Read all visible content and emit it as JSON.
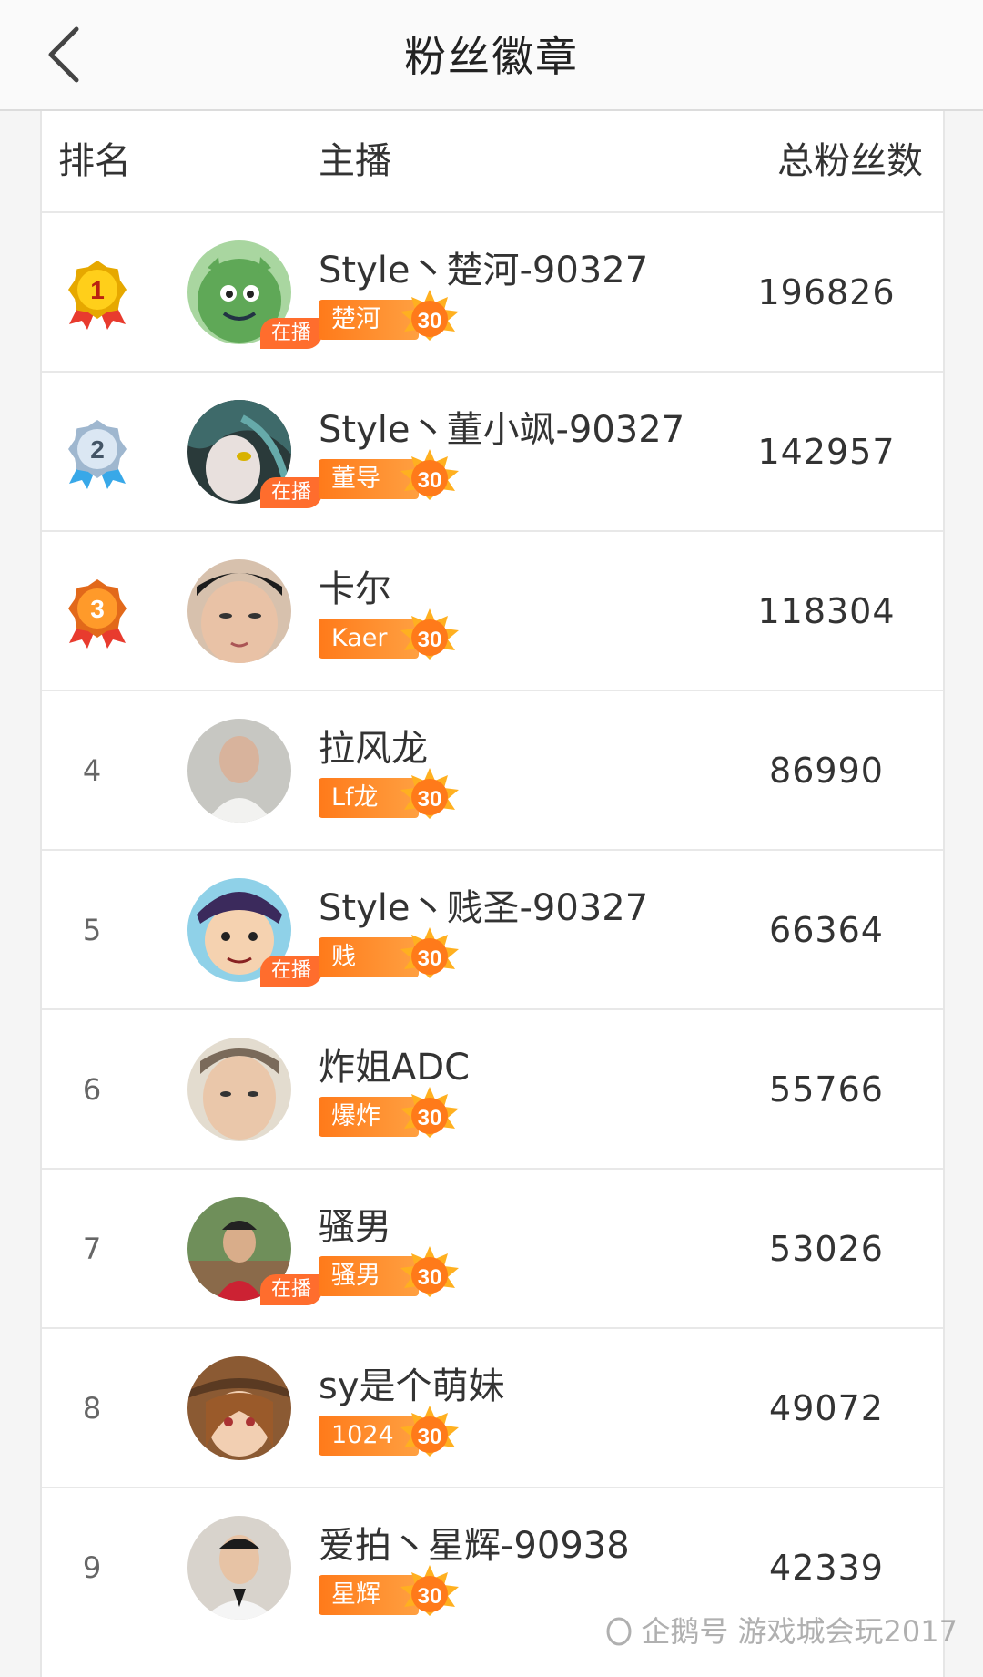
{
  "header": {
    "title": "粉丝徽章"
  },
  "columns": {
    "rank": "排名",
    "anchor": "主播",
    "fans": "总粉丝数"
  },
  "live_label": "在播",
  "colors": {
    "accent": "#ff7a1a",
    "gold": "#f5c400",
    "silver": "#b9cde0",
    "bronze": "#ff8c1a",
    "divider": "#e8e8e8"
  },
  "rows": [
    {
      "rank": "1",
      "medal": "gold-medal-icon",
      "name": "Style丶楚河-90327",
      "badge": "楚河",
      "level": "30",
      "fans": "196826",
      "live": true,
      "avatar": "green-monster-avatar"
    },
    {
      "rank": "2",
      "medal": "silver-medal-icon",
      "name": "Style丶董小飒-90327",
      "badge": "董导",
      "level": "30",
      "fans": "142957",
      "live": true,
      "avatar": "anime-girl-avatar"
    },
    {
      "rank": "3",
      "medal": "bronze-medal-icon",
      "name": "卡尔",
      "badge": "Kaer",
      "level": "30",
      "fans": "118304",
      "live": false,
      "avatar": "young-man-avatar"
    },
    {
      "rank": "4",
      "medal": null,
      "name": "拉风龙",
      "badge": "Lf龙",
      "level": "30",
      "fans": "86990",
      "live": false,
      "avatar": "bald-man-avatar"
    },
    {
      "rank": "5",
      "medal": null,
      "name": "Style丶贱圣-90327",
      "badge": "贱",
      "level": "30",
      "fans": "66364",
      "live": true,
      "avatar": "anime-pirate-avatar"
    },
    {
      "rank": "6",
      "medal": null,
      "name": "炸姐ADC",
      "badge": "爆炸",
      "level": "30",
      "fans": "55766",
      "live": false,
      "avatar": "boy-selfie-avatar"
    },
    {
      "rank": "7",
      "medal": null,
      "name": "骚男",
      "badge": "骚男",
      "level": "30",
      "fans": "53026",
      "live": true,
      "avatar": "man-outdoor-avatar"
    },
    {
      "rank": "8",
      "medal": null,
      "name": "sy是个萌妹",
      "badge": "1024",
      "level": "30",
      "fans": "49072",
      "live": false,
      "avatar": "cowgirl-anime-avatar"
    },
    {
      "rank": "9",
      "medal": null,
      "name": "爱拍丶星辉-90938",
      "badge": "星辉",
      "level": "30",
      "fans": "42339",
      "live": false,
      "avatar": "man-portrait-avatar"
    }
  ],
  "watermark": "企鹅号 游戏城会玩2017"
}
